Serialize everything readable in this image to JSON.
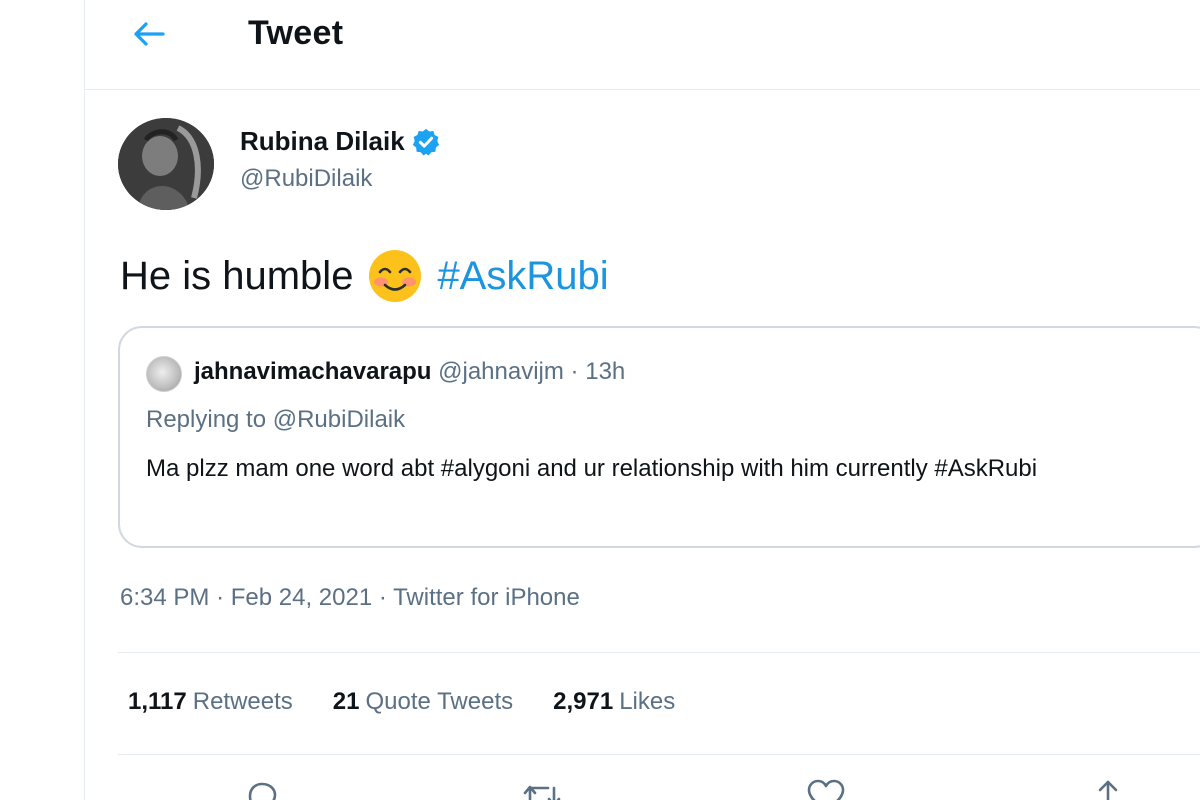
{
  "header": {
    "title": "Tweet",
    "back_icon": "arrow-left-icon",
    "accent": "#1da1f2"
  },
  "author": {
    "name": "Rubina Dilaik",
    "handle": "@RubiDilaik",
    "verified_icon": "verified-badge-icon"
  },
  "tweet": {
    "text": "He is humble",
    "emoji": "smiling-face-with-blush-icon",
    "hashtag": "#AskRubi"
  },
  "quote": {
    "name": "jahnavimachavarapu",
    "handle": "@jahnavijm",
    "separator": "·",
    "time": "13h",
    "replying_to": "Replying to @RubiDilaik",
    "body": "Ma plzz mam one word abt #alygoni and ur relationship with him currently #AskRubi"
  },
  "meta": {
    "time": "6:34 PM",
    "separator": "·",
    "date": "Feb 24, 2021",
    "source": "Twitter for iPhone"
  },
  "stats": {
    "retweets": {
      "count": "1,117",
      "label": "Retweets"
    },
    "quote_tweets": {
      "count": "21",
      "label": "Quote Tweets"
    },
    "likes": {
      "count": "2,971",
      "label": "Likes"
    }
  },
  "actions": [
    "reply-icon",
    "retweet-icon",
    "like-icon",
    "share-icon"
  ],
  "colors": {
    "hashtag": "#1b95e0",
    "secondary_text": "#5b7083",
    "divider": "#e6ecf0",
    "verified": "#1da1f2"
  }
}
